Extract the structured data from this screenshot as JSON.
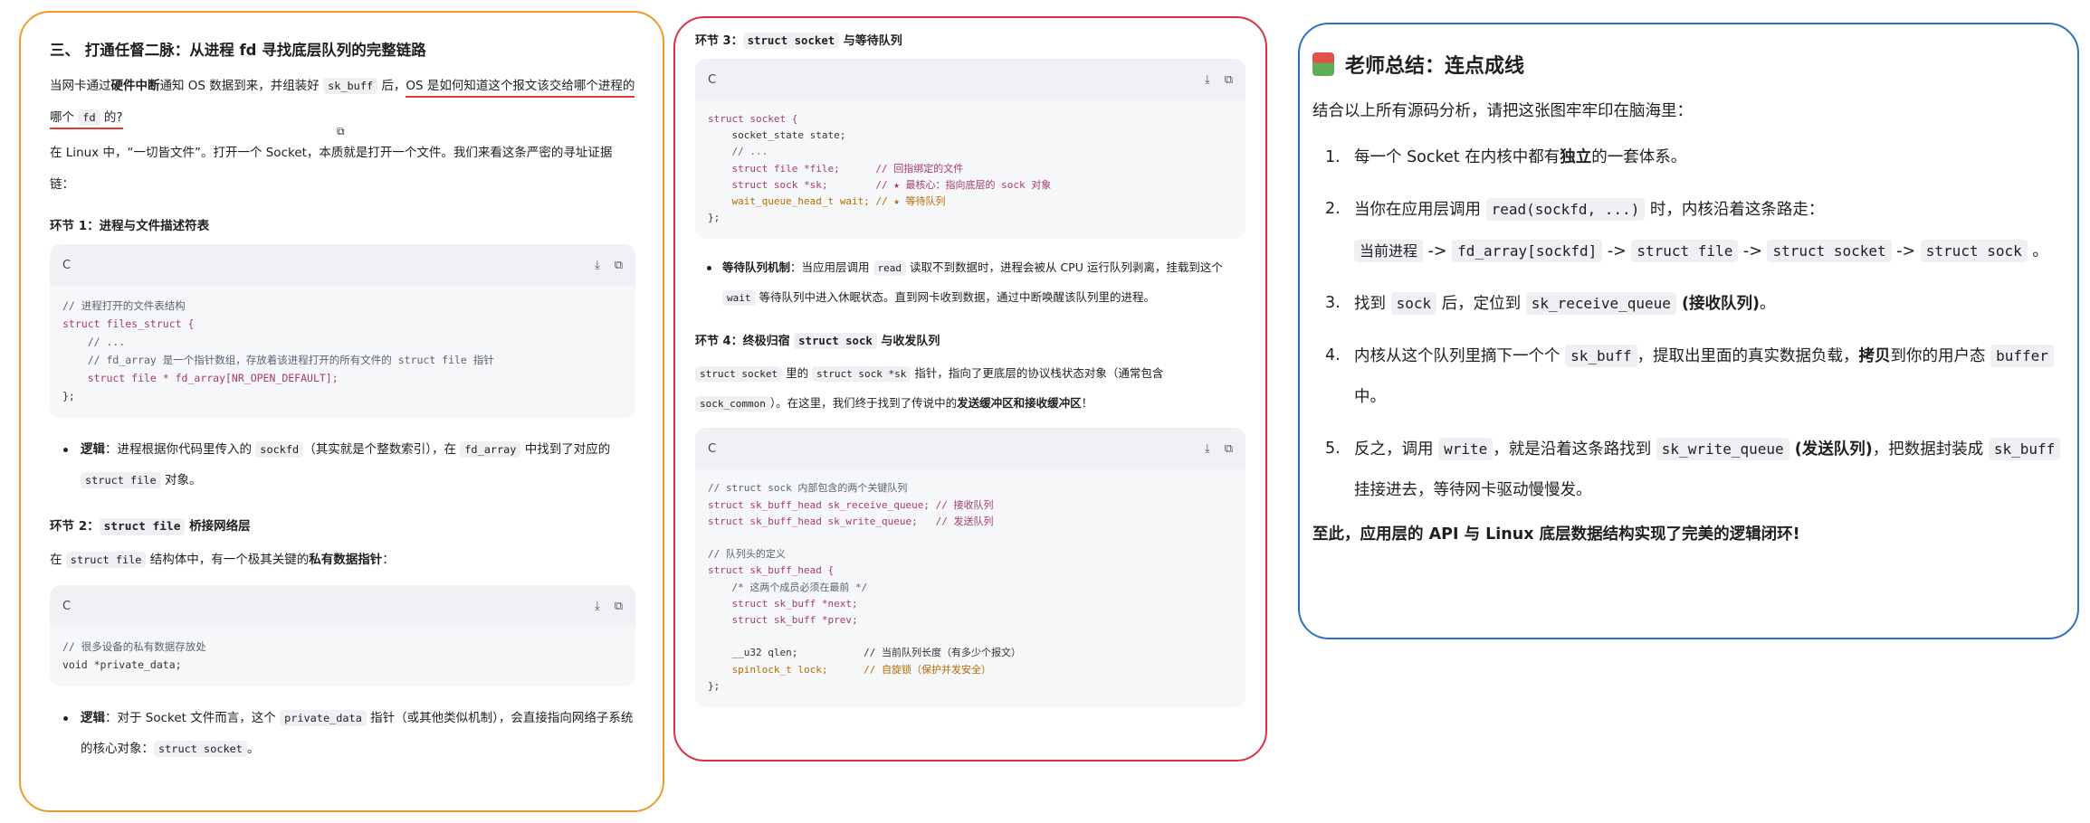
{
  "panel1": {
    "title": "三、 打通任督二脉：从进程 fd 寻找底层队列的完整链路",
    "intro": {
      "a": "当网卡通过",
      "b": "硬件中断",
      "c": "通知 OS 数据到来，并组装好 ",
      "code": "sk_buff",
      "d": " 后，",
      "e": "OS 是如何知道这个报文该交给哪个进程的哪个 ",
      "code2": "fd",
      "f": " 的?"
    },
    "intro2": "在 Linux 中，“一切皆文件”。打开一个 Socket，本质就是打开一个文件。我们来看这条严密的寻址证据链：",
    "sec1": {
      "title": "环节 1：进程与文件描述符表",
      "code_lang": "C",
      "code": [
        "// 进程打开的文件表结构",
        "struct files_struct {",
        "    // ...",
        "    // fd_array 是一个指针数组，存放着该进程打开的所有文件的 struct file 指针",
        "    struct file * fd_array[NR_OPEN_DEFAULT];",
        "};"
      ],
      "bullet": {
        "label": "逻辑",
        "a": "：进程根据你代码里传入的 ",
        "c1": "sockfd",
        "b": "（其实就是个整数索引），在 ",
        "c2": "fd_array",
        "c": " 中找到了对应的 ",
        "c3": "struct file",
        "d": " 对象。"
      }
    },
    "sec2": {
      "title_a": "环节 2：",
      "title_code": "struct file",
      "title_b": " 桥接网络层",
      "text_a": "在 ",
      "text_code": "struct file",
      "text_b": " 结构体中，有一个极其关键的",
      "text_bold": "私有数据指针",
      "text_c": "：",
      "code_lang": "C",
      "code": [
        "// 很多设备的私有数据存放处",
        "void *private_data;"
      ],
      "bullet": {
        "label": "逻辑",
        "a": "：对于 Socket 文件而言，这个 ",
        "c1": "private_data",
        "b": " 指针（或其他类似机制），会直接指向网络子系统的核心对象：",
        "c2": "struct socket",
        "c": "。"
      }
    }
  },
  "panel2": {
    "sec3": {
      "title_a": "环节 3：",
      "title_code": "struct socket",
      "title_b": " 与等待队列",
      "code_lang": "C",
      "code": [
        "struct socket {",
        "    socket_state state;",
        "    // ...",
        "    struct file *file;      // 回指绑定的文件",
        "    struct sock *sk;        // ★ 最核心：指向底层的 sock 对象",
        "    wait_queue_head_t wait; // ★ 等待队列",
        "};"
      ],
      "bullet": {
        "label": "等待队列机制",
        "a": "：当应用层调用 ",
        "c1": "read",
        "b": " 读取不到数据时，进程会被从 CPU 运行队列剥离，挂载到这个 ",
        "c2": "wait",
        "c": " 等待队列中进入休眠状态。直到网卡收到数据，通过中断唤醒该队列里的进程。"
      }
    },
    "sec4": {
      "title_a": "环节 4：终极归宿 ",
      "title_code": "struct sock",
      "title_b": " 与收发队列",
      "text": {
        "c1": "struct socket",
        "a": " 里的 ",
        "c2": "struct sock *sk",
        "b": " 指针，指向了更底层的协议栈状态对象（通常包含 ",
        "c3": "sock_common",
        "c": "）。在这里，我们终于找到了传说中的",
        "bold": "发送缓冲区和接收缓冲区",
        "d": "！"
      },
      "code_lang": "C",
      "code": [
        "// struct sock 内部包含的两个关键队列",
        "struct sk_buff_head sk_receive_queue; // 接收队列",
        "struct sk_buff_head sk_write_queue;   // 发送队列",
        "",
        "// 队列头的定义",
        "struct sk_buff_head {",
        "    /* 这两个成员必须在最前 */",
        "    struct sk_buff *next;",
        "    struct sk_buff *prev;",
        "",
        "    __u32 qlen;           // 当前队列长度（有多少个报文）",
        "    spinlock_t lock;      // 自旋锁（保护并发安全）",
        "};"
      ]
    }
  },
  "panel3": {
    "title": "老师总结：连点成线",
    "intro": "结合以上所有源码分析，请把这张图牢牢印在脑海里：",
    "items": {
      "i1": {
        "n": "1.",
        "a": "每一个 Socket 在内核中都有",
        "bold": "独立",
        "b": "的一套体系。"
      },
      "i2": {
        "n": "2.",
        "a": "当你在应用层调用 ",
        "c1": "read(sockfd, ...)",
        "b": " 时，内核沿着这条路走：",
        "c2": "当前进程",
        "arrow": " -> ",
        "c3": "fd_array[sockfd]",
        "c4": "struct file",
        "c5": "struct socket",
        "c6": "struct sock",
        "end": " 。"
      },
      "i3": {
        "n": "3.",
        "a": "找到 ",
        "c1": "sock",
        "b": " 后，定位到 ",
        "c2": "sk_receive_queue",
        "bold": " (接收队列)",
        "c": "。"
      },
      "i4": {
        "n": "4.",
        "a": "内核从这个队列里摘下一个个 ",
        "c1": "sk_buff",
        "b": "，提取出里面的真实数据负载，",
        "bold": "拷贝",
        "c": "到你的用户态 ",
        "c2": "buffer",
        "d": " 中。"
      },
      "i5": {
        "n": "5.",
        "a": "反之，调用 ",
        "c1": "write",
        "b": "，就是沿着这条路找到 ",
        "c2": "sk_write_queue",
        "bold": " (发送队列)",
        "c": "，把数据封装成 ",
        "c3": "sk_buff",
        "d": " 挂接进去，等待网卡驱动慢慢发。"
      }
    },
    "conclusion": "至此，应用层的 API 与 Linux 底层数据结构实现了完美的逻辑闭环!"
  },
  "icons": {
    "download": "download-icon",
    "copy": "copy-icon"
  }
}
